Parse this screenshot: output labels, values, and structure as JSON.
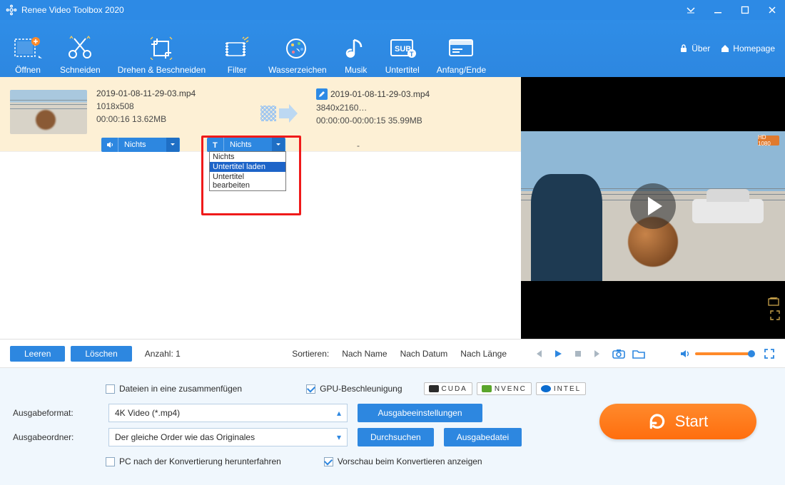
{
  "titlebar": {
    "title": "Renee Video Toolbox 2020"
  },
  "toolbar": {
    "open": "Öffnen",
    "cut": "Schneiden",
    "rotate_crop": "Drehen & Beschneiden",
    "filter": "Filter",
    "watermark": "Wasserzeichen",
    "music": "Musik",
    "subtitle": "Untertitel",
    "startend": "Anfang/Ende",
    "about": "Über",
    "homepage": "Homepage"
  },
  "file": {
    "src": {
      "name": "2019-01-08-11-29-03.mp4",
      "res": "1018x508",
      "dursize": "00:00:16  13.62MB"
    },
    "dst": {
      "name": "2019-01-08-11-29-03.mp4",
      "res": "3840x2160…",
      "dursize": "00:00:00-00:00:15  35.99MB"
    },
    "audio_pill": "Nichts",
    "sub_pill": "Nichts",
    "dash": "-",
    "sub_menu": {
      "opt_none": "Nichts",
      "opt_load": "Untertitel laden",
      "opt_edit": "Untertitel bearbeiten"
    }
  },
  "preview": {
    "hd": "HD 1080"
  },
  "controls": {
    "clear": "Leeren",
    "delete": "Löschen",
    "count_label": "Anzahl:",
    "count_value": "1",
    "sort_label": "Sortieren:",
    "sort_name": "Nach Name",
    "sort_date": "Nach Datum",
    "sort_length": "Nach Länge"
  },
  "settings": {
    "merge": "Dateien in eine zusammenfügen",
    "gpu": "GPU-Beschleunigung",
    "badges": {
      "cuda": "CUDA",
      "nvenc": "NVENC",
      "intel": "INTEL"
    },
    "format_label": "Ausgabeformat:",
    "format_value": "4K Video (*.mp4)",
    "outconf": "Ausgabeeinstellungen",
    "folder_label": "Ausgabeordner:",
    "folder_value": "Der gleiche Order wie das Originales",
    "browse": "Durchsuchen",
    "outfile": "Ausgabedatei",
    "shutdown": "PC nach der Konvertierung herunterfahren",
    "preview_convert": "Vorschau beim Konvertieren anzeigen",
    "start": "Start"
  }
}
